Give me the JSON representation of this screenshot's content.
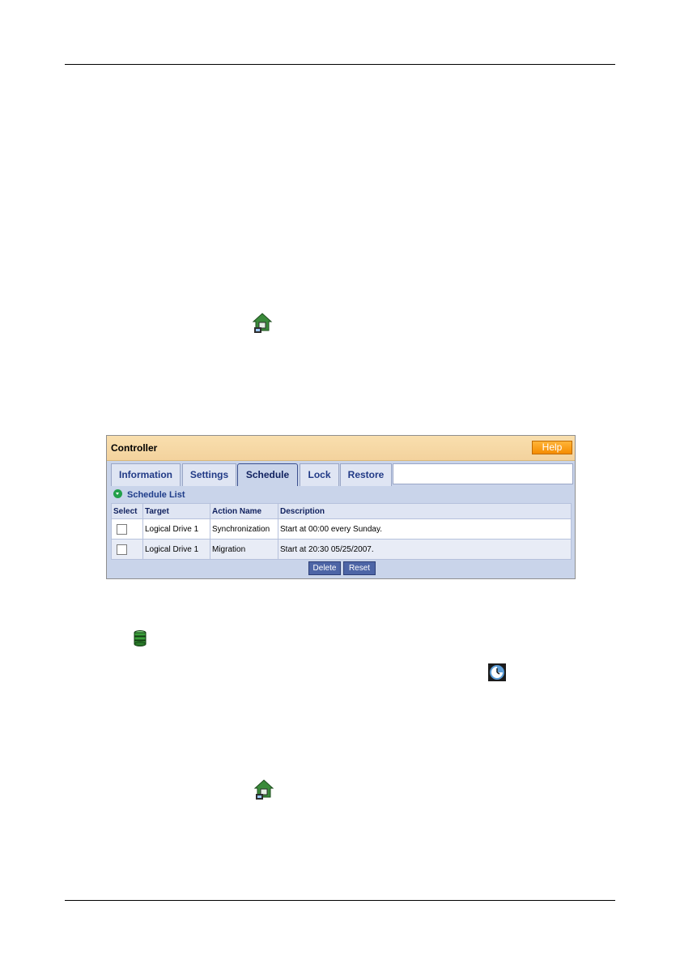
{
  "panel": {
    "title": "Controller",
    "help_label": "Help",
    "tabs": [
      {
        "label": "Information"
      },
      {
        "label": "Settings"
      },
      {
        "label": "Schedule"
      },
      {
        "label": "Lock"
      },
      {
        "label": "Restore"
      }
    ],
    "active_tab": "Schedule",
    "section_title": "Schedule List",
    "columns": [
      "Select",
      "Target",
      "Action Name",
      "Description"
    ],
    "rows": [
      {
        "selected": false,
        "target": "Logical Drive 1",
        "action": "Synchronization",
        "description": "Start at 00:00 every Sunday."
      },
      {
        "selected": false,
        "target": "Logical Drive 1",
        "action": "Migration",
        "description": "Start at 20:30 05/25/2007."
      }
    ],
    "buttons": {
      "delete": "Delete",
      "reset": "Reset"
    }
  },
  "icons": {
    "top": "controller-icon",
    "middle_left": "logical-drive-icon",
    "middle_right": "schedule-icon",
    "bottom": "controller-icon"
  },
  "colors": {
    "header": "#f6d8a4",
    "help": "#f58c00",
    "panel": "#c9d4ea",
    "tab_text": "#213a86",
    "button": "#4d65a6"
  }
}
